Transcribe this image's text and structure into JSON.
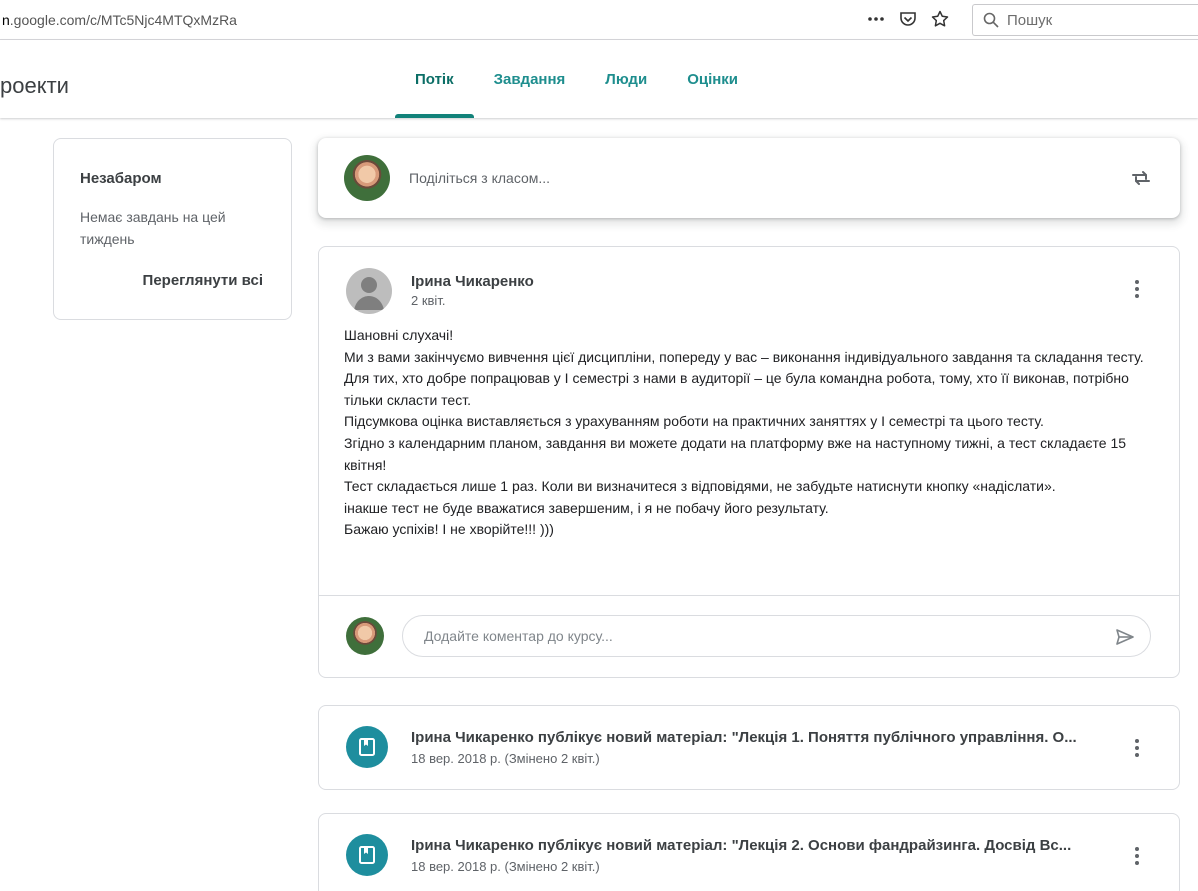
{
  "browser": {
    "url_prefix": ".google.com/c/MTc5Njc4MTQxMzRa",
    "url_host_lead": "n",
    "search_placeholder": "Пошук",
    "icons": [
      "more-icon",
      "pocket-icon",
      "bookmark-star-icon",
      "search-icon"
    ]
  },
  "header": {
    "class_title": "роекти",
    "tabs": [
      {
        "label": "Потік",
        "active": true
      },
      {
        "label": "Завдання",
        "active": false
      },
      {
        "label": "Люди",
        "active": false
      },
      {
        "label": "Оцінки",
        "active": false
      }
    ]
  },
  "upcoming": {
    "title": "Незабаром",
    "empty_text": "Немає завдань на цей тиждень",
    "view_all": "Переглянути всі"
  },
  "share": {
    "placeholder": "Поділіться з класом..."
  },
  "post": {
    "author": "Ірина Чикаренко",
    "date": "2 квіт.",
    "body": [
      "Шановні слухачі!",
      "Ми з вами закінчуємо вивчення цієї дисципліни, попереду у вас – виконання індивідуального завдання та складання тесту.",
      "Для тих, хто добре попрацював у I семестрі з нами в аудиторії – це була командна робота, тому, хто її виконав, потрібно тільки скласти тест.",
      "Підсумкова оцінка виставляється з урахуванням роботи на практичних заняттях у I семестрі та цього тесту.",
      "Згідно з календарним планом, завдання ви можете додати на платформу вже на наступному тижні, а тест складаєте 15 квітня!",
      "Тест складається лише 1 раз. Коли ви визначитеся з відповідями, не забудьте натиснути кнопку «надіслати».",
      "інакше тест не буде вважатися завершеним, і я не побачу його результату.",
      "Бажаю успіхів! І не хворійте!!! )))"
    ],
    "comment_placeholder": "Додайте коментар до курсу..."
  },
  "materials": [
    {
      "title": "Ірина Чикаренко публікує новий матеріал: \"Лекція 1. Поняття публічного управління. О...",
      "date": "18 вер. 2018 р. (Змінено 2 квіт.)"
    },
    {
      "title": "Ірина Чикаренко публікує новий матеріал: \"Лекція 2. Основи фандрайзинга. Досвід Вс...",
      "date": "18 вер. 2018 р. (Змінено 2 квіт.)"
    }
  ],
  "colors": {
    "accent": "#12827a",
    "tab_text": "#1e8e8e",
    "material_icon_bg": "#1e8e9e"
  }
}
